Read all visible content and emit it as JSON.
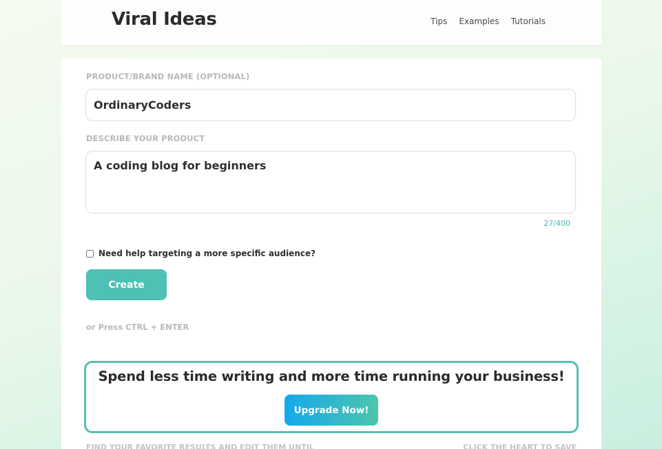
{
  "header": {
    "logo": "Viral Ideas",
    "nav": [
      "Tips",
      "Examples",
      "Tutorials"
    ]
  },
  "form": {
    "product_label": "PRODUCT/BRAND NAME (OPTIONAL)",
    "product_value": "OrdinaryCoders",
    "describe_label": "DESCRIBE YOUR PRODUCT",
    "describe_value": "A coding blog for beginners",
    "char_count": "27/400",
    "audience_checkbox_label": "Need help targeting a more specific audience?",
    "audience_checked": false,
    "create_label": "Create",
    "shortcut_hint": "or Press CTRL + ENTER"
  },
  "promo": {
    "title": "Spend less time writing and more time running your business!",
    "button_label": "Upgrade Now!"
  },
  "footer": {
    "left_text": "FIND YOUR FAVORITE RESULTS AND EDIT THEM UNTIL",
    "right_text": "CLICK THE HEART TO SAVE"
  },
  "colors": {
    "accent": "#4dc1b4",
    "promo_border": "#54bfb3",
    "upgrade_gradient_start": "#14a8ec",
    "upgrade_gradient_end": "#4cc6ad"
  }
}
